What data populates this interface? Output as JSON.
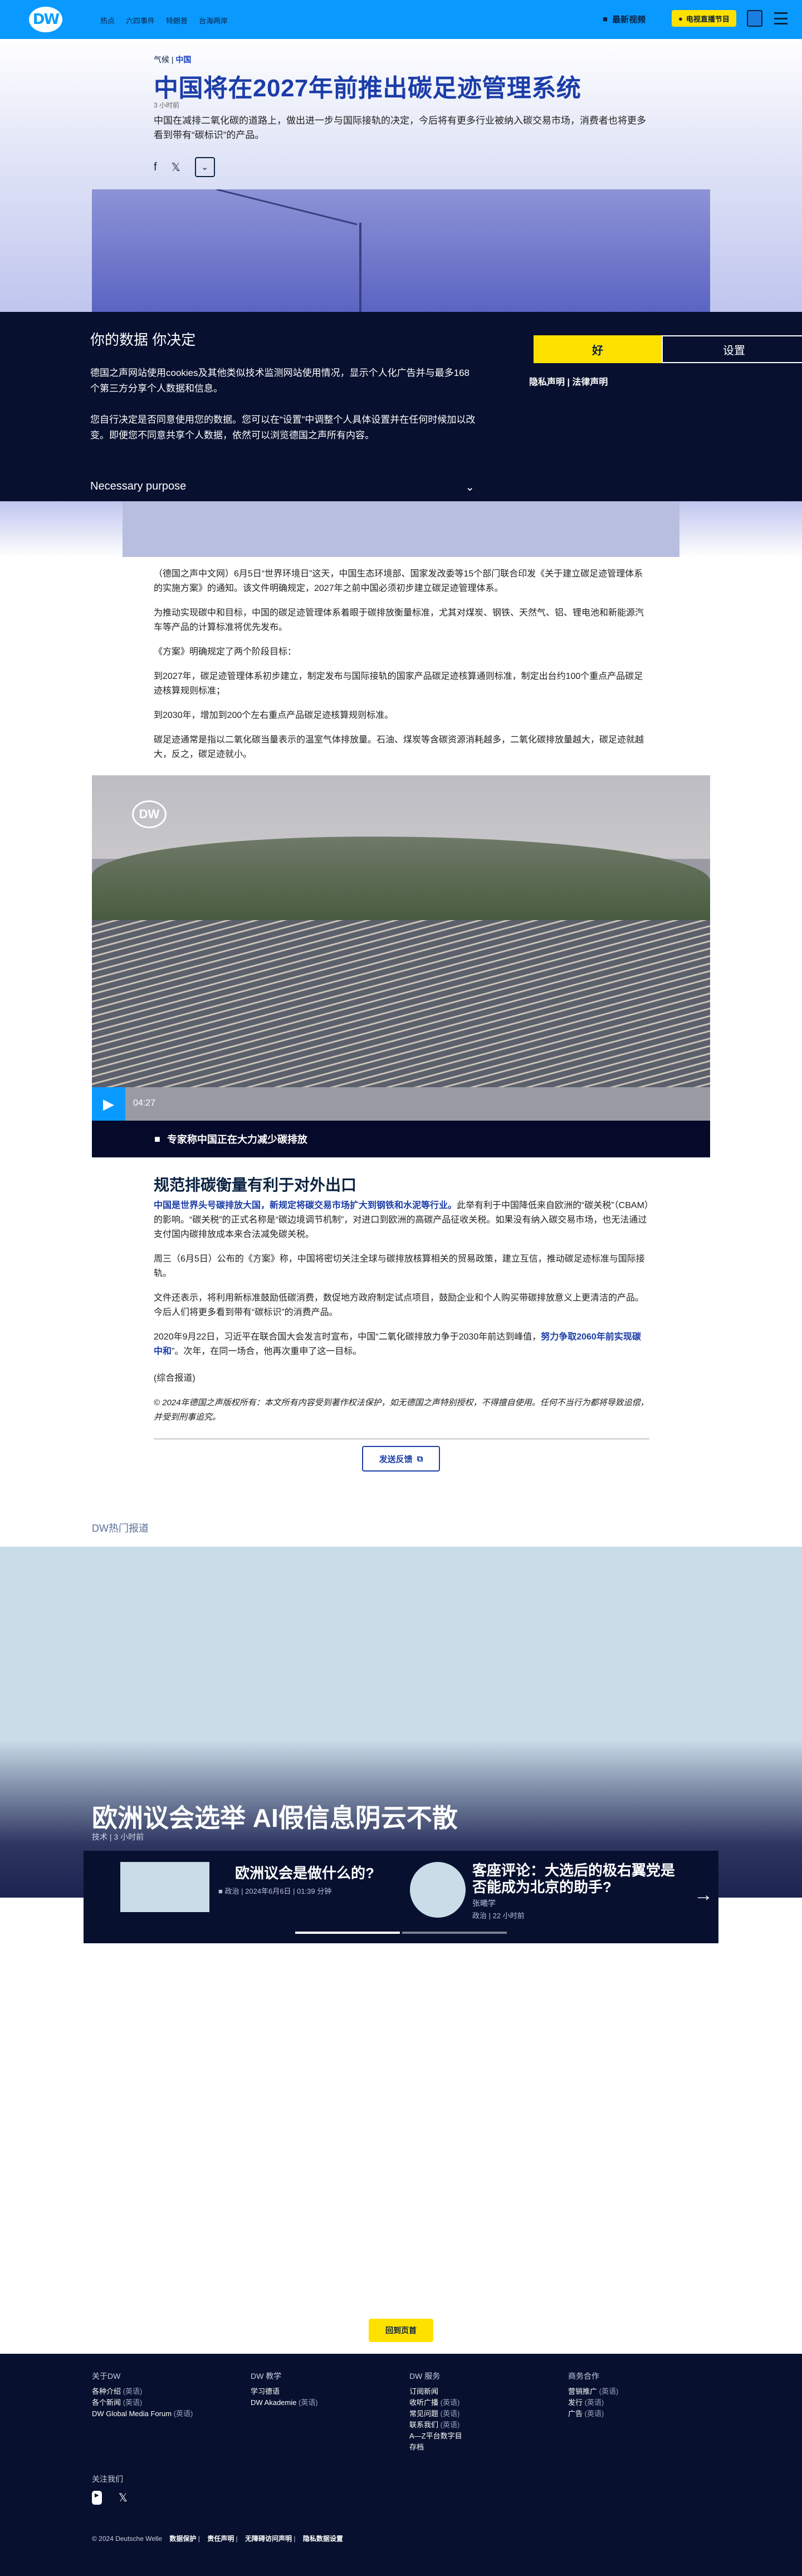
{
  "header": {
    "logo": "DW",
    "nav": [
      "热点",
      "六四事件",
      "特朗普",
      "台海两岸"
    ],
    "latest_video": "最新视频",
    "tv_button": "电视直播节目"
  },
  "article": {
    "kicker_category": "气候",
    "kicker_region": "中国",
    "title": "中国将在2027年前推出碳足迹管理系统",
    "timestamp": "3 小时前",
    "lead": "中国在减排二氧化碳的道路上，做出进一步与国际接轨的决定，今后将有更多行业被纳入碳交易市场，消费者也将更多看到带有“碳标识”的产品。",
    "paragraphs": [
      "（德国之声中文网）6月5日“世界环境日”这天，中国生态环境部、国家发改委等15个部门联合印发《关于建立碳足迹管理体系的实施方案》的通知。该文件明确规定，2027年之前中国必须初步建立碳足迹管理体系。",
      "为推动实现碳中和目标，中国的碳足迹管理体系着眼于碳排放衡量标准，尤其对煤炭、钢铁、天然气、铝、锂电池和新能源汽车等产品的计算标准将优先发布。",
      "《方案》明确规定了两个阶段目标：",
      "到2027年，碳足迹管理体系初步建立，制定发布与国际接轨的国家产品碳足迹核算通则标准，制定出台约100个重点产品碳足迹核算规则标准；",
      "到2030年，增加到200个左右重点产品碳足迹核算规则标准。",
      "碳足迹通常是指以二氧化碳当量表示的温室气体排放量。石油、煤炭等含碳资源消耗越多，二氧化碳排放量越大，碳足迹就越大，反之，碳足迹就小。"
    ],
    "video_duration": "04:27",
    "video_caption": "专家称中国正在大力减少碳排放",
    "subheading": "规范排碳衡量有利于对外出口",
    "p2_highlight": "中国是世界头号碳排放大国，新规定将碳交易市场扩大到钢铁和水泥等行业。",
    "p2_rest": "此举有利于中国降低来自欧洲的“碳关税”（CBAM）的影响。“碳关税”的正式名称是“碳边境调节机制”，对进口到欧洲的高碳产品征收关税。如果没有纳入碳交易市场，也无法通过支付国内碳排放成本来合法减免碳关税。",
    "p3": "周三（6月5日）公布的《方案》称，中国将密切关注全球与碳排放核算相关的贸易政策，建立互信，推动碳足迹标准与国际接轨。",
    "p4": "文件还表示，将利用新标准鼓励低碳消费，数促地方政府制定试点项目，鼓励企业和个人购买带碳排放意义上更清洁的产品。今后人们将更多看到带有“碳标识”的消费产品。",
    "p5_start": "2020年9月22日，习近平在联合国大会发言时宣布，中国“二氧化碳排放力争于2030年前达到峰值，",
    "p5_highlight": "努力争取2060年前实现碳中和",
    "p5_end": "”。次年，在同一场合，他再次重申了这一目标。",
    "source": "(综合报道)",
    "copyright": "© 2024年德国之声版权所有：本文所有内容受到著作权法保护，如无德国之声特别授权，不得擅自使用。任何不当行为都将导致追偿，并受到刑事追究。",
    "feedback_button": "发送反馈"
  },
  "cookie": {
    "heading": "你的数据 你决定",
    "text1": "德国之声网站使用cookies及其他类似技术监测网站使用情况，显示个人化广告并与最多168 个第三方分享个人数据和信息。",
    "text2": "您自行决定是否同意使用您的数据。您可以在“设置”中调整个人具体设置并在任何时候加以改变。即便您不同意共享个人数据，依然可以浏览德国之声所有内容。",
    "accept_button": "好",
    "settings_button": "设置",
    "privacy": "隐私声明",
    "legal": "法律声明",
    "necessary": "Necessary purpose"
  },
  "hot_news": {
    "label": "DW热门报道",
    "headline": "欧洲议会选举 AI假信息阴云不散",
    "headline_category": "技术",
    "headline_time": "3 小时前",
    "cards": [
      {
        "title": "欧洲议会是做什么的?",
        "meta_category": "政治",
        "meta_date": "2024年6月6日",
        "meta_duration": "01:39 分钟"
      },
      {
        "title": "客座评论：大选后的极右翼党是否能成为北京的助手?",
        "author": "张曦学",
        "meta_category": "政治",
        "meta_time": "22 小时前"
      }
    ]
  },
  "back_to_top": "回到页首",
  "footer": {
    "columns": [
      {
        "heading": "关于DW",
        "items": [
          {
            "label": "各种介绍",
            "lang": "(英语)"
          },
          {
            "label": "各个新闻",
            "lang": "(英语)"
          },
          {
            "label": "DW Global Media Forum",
            "lang": "(英语)"
          }
        ]
      },
      {
        "heading": "DW 教学",
        "items": [
          {
            "label": "学习德语",
            "lang": ""
          },
          {
            "label": "DW Akademie",
            "lang": "(英语)"
          }
        ]
      },
      {
        "heading": "DW 服务",
        "items": [
          {
            "label": "订阅新闻",
            "lang": ""
          },
          {
            "label": "收听广播",
            "lang": "(英语)"
          },
          {
            "label": "常见问题",
            "lang": "(英语)"
          },
          {
            "label": "联系我们",
            "lang": "(英语)"
          },
          {
            "label": "A—Z平台数字目",
            "lang": ""
          },
          {
            "label": "存档",
            "lang": ""
          }
        ]
      },
      {
        "heading": "商务合作",
        "items": [
          {
            "label": "营销推广",
            "lang": "(英语)"
          },
          {
            "label": "发行",
            "lang": "(英语)"
          },
          {
            "label": "广告",
            "lang": "(英语)"
          }
        ]
      }
    ],
    "follow": "关注我们",
    "copyright": "© 2024 Deutsche Welle",
    "links": [
      "数据保护",
      "责任声明",
      "无障碍访问声明",
      "隐私数据设置"
    ]
  },
  "colors": {
    "brand_blue": "#0a9aff",
    "title_blue": "#1b3da8",
    "navy": "#07102e",
    "accent_yellow": "#ffe100"
  }
}
